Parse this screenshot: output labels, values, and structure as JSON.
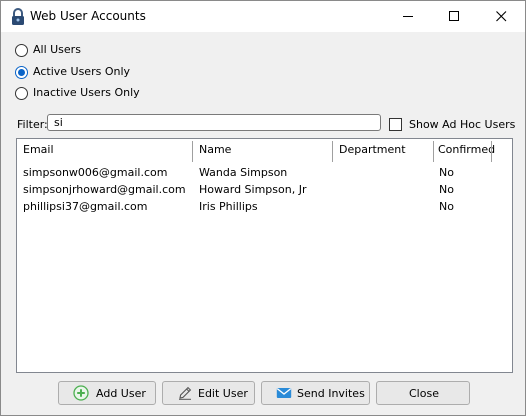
{
  "window": {
    "title": "Web User Accounts"
  },
  "filters": {
    "radios": [
      {
        "label": "All Users",
        "checked": false
      },
      {
        "label": "Active Users Only",
        "checked": true
      },
      {
        "label": "Inactive Users Only",
        "checked": false
      }
    ],
    "filter_label": "Filter:",
    "filter_value": "si",
    "adhoc_label": "Show Ad Hoc Users",
    "adhoc_checked": false
  },
  "table": {
    "columns": [
      "Email",
      "Name",
      "Department",
      "Confirmed"
    ],
    "rows": [
      {
        "email": "simpsonw006@gmail.com",
        "name": "Wanda Simpson",
        "department": "",
        "confirmed": "No"
      },
      {
        "email": "simpsonjrhoward@gmail.com",
        "name": "Howard Simpson, Jr",
        "department": "",
        "confirmed": "No"
      },
      {
        "email": "phillipsi37@gmail.com",
        "name": "Iris Phillips",
        "department": "",
        "confirmed": "No"
      }
    ]
  },
  "buttons": {
    "add": "Add User",
    "edit": "Edit User",
    "invite": "Send Invites",
    "close": "Close"
  },
  "icons": {
    "title": "padlock-icon",
    "add": "plus-circle-icon",
    "edit": "pencil-icon",
    "invite": "envelope-icon"
  },
  "colors": {
    "accent": "#0a64c8",
    "add_icon": "#4caf50",
    "invite_icon": "#2a8bd8"
  }
}
